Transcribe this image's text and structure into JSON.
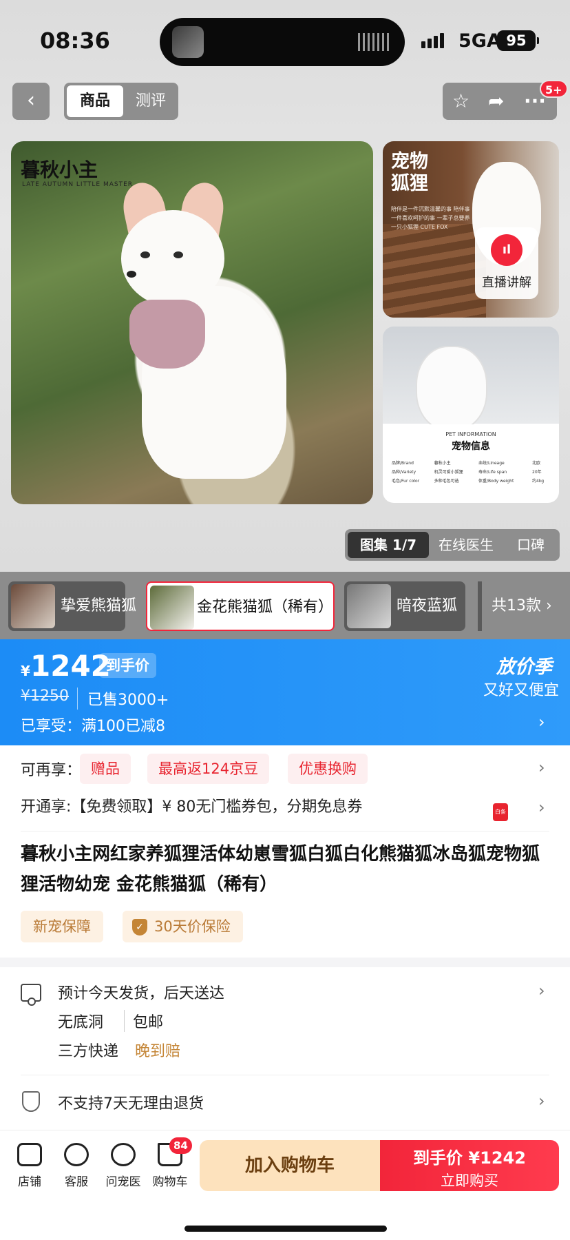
{
  "status_bar": {
    "time": "08:36",
    "network": "5GA",
    "battery": "95"
  },
  "nav": {
    "back_icon": "chevron-left-icon",
    "tab_product": "商品",
    "tab_review": "测评",
    "star_icon": "star-icon",
    "share_icon": "share-icon",
    "more_icon": "more-icon",
    "more_badge": "5+"
  },
  "gallery": {
    "main_title": "暮秋小主",
    "main_subtitle": "LATE AUTUMN LITTLE MASTER",
    "side1_title_l1": "宠物",
    "side1_title_l2": "狐狸",
    "side1_text": "陪伴是一件沉默温馨的事 陪伴事一件喜欢呵护的事 一辈子总要养一只小狐狸 CUTE FOX",
    "live_label": "直播讲解",
    "info_en": "PET INFORMATION",
    "info_zh": "宠物信息",
    "info_rows": [
      [
        "品牌/Brand",
        "暮秋小主",
        "血统/Lineage",
        "北欧"
      ],
      [
        "品种/Variety",
        "机灵可爱小狐狸",
        "寿命/Life span",
        "20年"
      ],
      [
        "毛色/Fur color",
        "多种毛色可选",
        "体重/Body weight",
        "约4kg"
      ]
    ],
    "tab_gallery": "图集 1/7",
    "tab_doctor": "在线医生",
    "tab_reputation": "口碑"
  },
  "variants": {
    "items": [
      {
        "label": "挚爱熊猫狐",
        "selected": false
      },
      {
        "label": "金花熊猫狐（稀有）",
        "selected": true
      },
      {
        "label": "暗夜蓝狐",
        "selected": false
      }
    ],
    "more": "共13款 ›"
  },
  "price": {
    "currency": "¥",
    "value": "1242",
    "tag": "到手价",
    "original": "¥1250",
    "sold": "已售3000+",
    "promo": "已享受：满100已减8",
    "season_title": "放价季",
    "season_sub": "又好又便宜",
    "accent": "#1c8cf6"
  },
  "benefits": {
    "label": "可再享：",
    "chips": [
      "赠品",
      "最高返124京豆",
      "优惠换购"
    ],
    "open_text": "开通享:【免费领取】¥ 80无门槛券包，分期免息券",
    "baitiao_icon": "白条"
  },
  "product": {
    "title": "暮秋小主网红家养狐狸活体幼崽雪狐白狐白化熊猫狐冰岛狐宠物狐狸活物幼宠 金花熊猫狐（稀有）",
    "tag_new": "新宠保障",
    "tag_price": "30天价保险"
  },
  "shipping": {
    "line1": "预计今天发货，后天送达",
    "line2a": "无底洞",
    "line2b": "包邮",
    "line3a": "三方快递",
    "line3b": "晚到赔",
    "return": "不支持7天无理由退货"
  },
  "bottom_bar": {
    "store": "店铺",
    "service": "客服",
    "doctor": "问宠医",
    "cart": "购物车",
    "cart_badge": "84",
    "add_to_cart": "加入购物车",
    "buy_price": "到手价 ¥1242",
    "buy_now": "立即购买",
    "buy_color": "#f2253a"
  }
}
